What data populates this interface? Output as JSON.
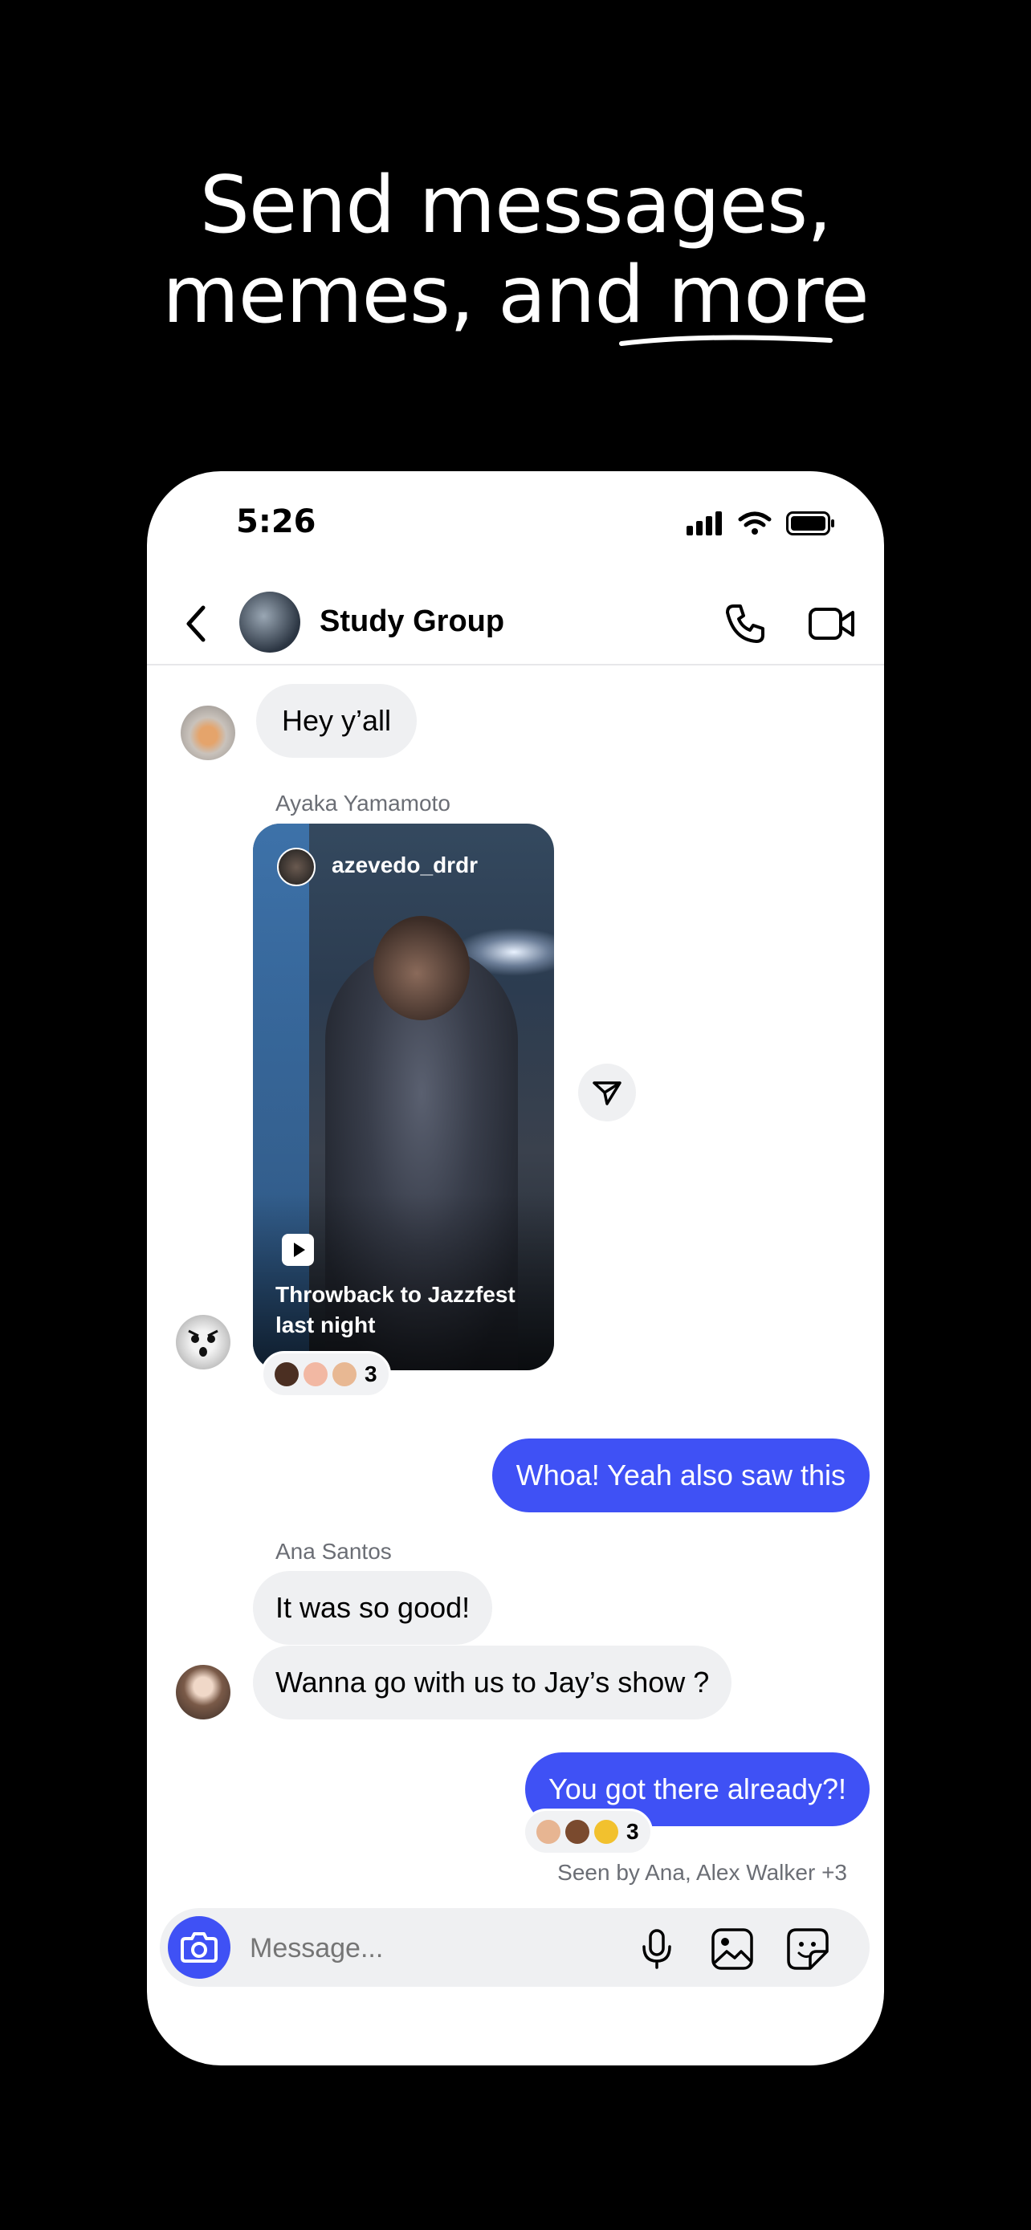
{
  "promo": {
    "line1": "Send messages,",
    "line2_prefix": "memes, and ",
    "line2_highlight": "more"
  },
  "status_bar": {
    "time": "5:26"
  },
  "header": {
    "title": "Study Group"
  },
  "messages": {
    "m1": "Hey y’all",
    "reel_sender": "Ayaka Yamamoto",
    "reel_user": "azevedo_drdr",
    "reel_caption": "Throwback to Jazzfest last night",
    "reel_reaction_count": "3",
    "m2": "Whoa! Yeah also saw this",
    "ana_sender": "Ana Santos",
    "m3": "It was so good!",
    "m4": "Wanna go with us to Jay’s show ?",
    "m5": "You got there already?!",
    "m5_reaction_count": "3",
    "seen": "Seen by Ana, Alex Walker +3"
  },
  "composer": {
    "placeholder": "Message..."
  },
  "icons": {
    "back": "chevron-left-icon",
    "call": "phone-icon",
    "video": "video-camera-icon",
    "share": "send-icon",
    "camera": "camera-icon",
    "mic": "microphone-icon",
    "gallery": "image-icon",
    "sticker": "sticker-icon"
  },
  "colors": {
    "accent": "#3f51f5",
    "bubble_in": "#eff0f2",
    "background": "#000000"
  }
}
